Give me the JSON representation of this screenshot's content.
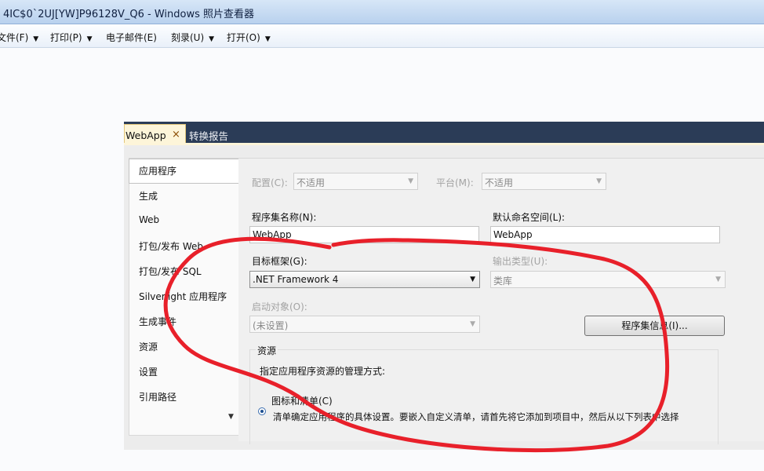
{
  "window": {
    "title": "4IC$0`2UJ[YW]P96128V_Q6 - Windows 照片查看器"
  },
  "menubar": {
    "items": [
      {
        "label": "文件(F)",
        "has_dropdown": true
      },
      {
        "label": "打印(P)",
        "has_dropdown": true
      },
      {
        "label": "电子邮件(E)",
        "has_dropdown": false
      },
      {
        "label": "刻录(U)",
        "has_dropdown": true
      },
      {
        "label": "打开(O)",
        "has_dropdown": true
      }
    ],
    "dropdown_glyph": "▼"
  },
  "vs": {
    "tabs": [
      {
        "label": "WebApp",
        "active": true,
        "close_glyph": "×"
      },
      {
        "label": "转换报告",
        "active": false
      }
    ],
    "nav": {
      "items": [
        "应用程序",
        "生成",
        "Web",
        "打包/发布 Web",
        "打包/发布 SQL",
        "Silverlight 应用程序",
        "生成事件",
        "资源",
        "设置",
        "引用路径"
      ],
      "selected": "应用程序",
      "scroll_glyph": "▼"
    },
    "form": {
      "config_label": "配置(C):",
      "config_value": "不适用",
      "platform_label": "平台(M):",
      "platform_value": "不适用",
      "assembly_label": "程序集名称(N):",
      "assembly_value": "WebApp",
      "namespace_label": "默认命名空间(L):",
      "namespace_value": "WebApp",
      "framework_label": "目标框架(G):",
      "framework_value": ".NET Framework 4",
      "output_label": "输出类型(U):",
      "output_value": "类库",
      "startup_label": "启动对象(O):",
      "startup_value": "(未设置)",
      "assembly_info_button": "程序集信息(I)...",
      "resources_group_title": "资源",
      "resources_desc": "指定应用程序资源的管理方式:",
      "radio_icon_manifest": "图标和清单(C)",
      "radio_desc": "清单确定应用程序的具体设置。要嵌入自定义清单，请首先将它添加到项目中，然后从以下列表中选择"
    },
    "dropdown_glyph": "▼"
  },
  "colors": {
    "scribble": "#e8202a",
    "tab_bar": "#2b3c57",
    "active_tab": "#fdf5d9"
  }
}
